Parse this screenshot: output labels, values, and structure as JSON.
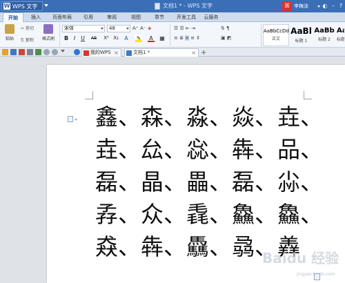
{
  "titlebar": {
    "app_name": "WPS 文字",
    "window_title": "文档1 * - WPS 文字",
    "user_name": "李梅涂",
    "avatar_glyph": "ꕤ"
  },
  "menu": {
    "tabs": [
      "开始",
      "插入",
      "页面布局",
      "引用",
      "审阅",
      "视图",
      "章节",
      "开发工具",
      "云服务"
    ]
  },
  "ribbon": {
    "paste_label": "粘贴",
    "cut_label": "剪切",
    "copy_label": "复制",
    "format_painter_label": "格式刷",
    "font_name": "宋体",
    "font_size": "48",
    "format_buttons": [
      "B",
      "I",
      "U",
      "AB",
      "X²",
      "X₂",
      "A"
    ],
    "styles": [
      {
        "sample": "AaBbCcDd",
        "label": "正文"
      },
      {
        "sample": "AaBl",
        "label": "标题 1"
      },
      {
        "sample": "AaBb",
        "label": "标题 2"
      },
      {
        "sample": "Aa",
        "label": "标题"
      }
    ]
  },
  "doctabs": {
    "tab1": "我的WPS",
    "tab2": "文档1 *",
    "new_tab": "+"
  },
  "document": {
    "lines": [
      "鑫、森、淼、焱、垚、",
      "垚、厽、惢、犇、品、",
      "磊、晶、畾、磊、尛、",
      "孨、众、毳、鱻、鱻、",
      "猋、犇、驫、骉、羴"
    ]
  },
  "watermark": {
    "text": "Baidu 经验",
    "sub": "jingyan.baidu.com"
  },
  "colors": {
    "titlebar": "#3a6fb8",
    "menubar": "#cfdced",
    "ribbon": "#f3f6fa",
    "workspace": "#dfe3e8"
  }
}
